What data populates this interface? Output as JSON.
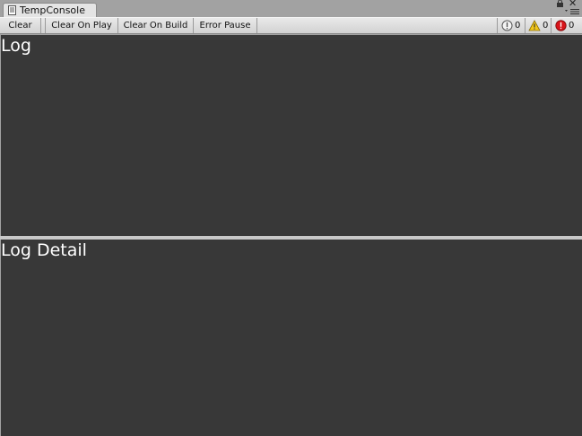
{
  "window": {
    "tab_title": "TempConsole",
    "tab_icon": "console-window-icon"
  },
  "toolbar": {
    "clear_label": "Clear",
    "clear_on_play_label": "Clear On Play",
    "clear_on_build_label": "Clear On Build",
    "error_pause_label": "Error Pause",
    "info_count": "0",
    "warning_count": "0",
    "error_count": "0"
  },
  "panels": {
    "log_title": "Log",
    "detail_title": "Log Detail"
  },
  "colors": {
    "panel_bg": "#383838",
    "warning": "#f3c81a",
    "error": "#d8141a"
  }
}
